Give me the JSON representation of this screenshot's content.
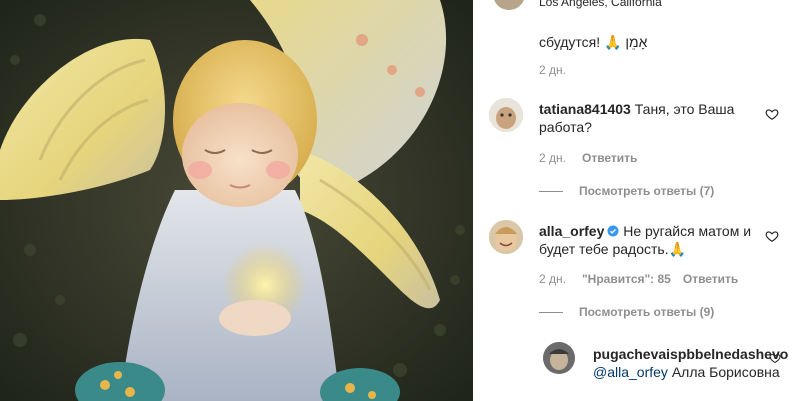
{
  "post": {
    "location": "Los Angeles, California"
  },
  "comments": [
    {
      "text": "сбудутся! 🙏 אָמֵן",
      "time": "2 дн."
    },
    {
      "username": "tatiana841403",
      "text": "Таня, это Ваша работа?",
      "time": "2 дн.",
      "reply_label": "Ответить",
      "view_replies": "Посмотреть ответы (7)"
    },
    {
      "username": "alla_orfey",
      "verified": true,
      "text": "Не ругайся матом и будет тебе радость.🙏",
      "time": "2 дн.",
      "likes": "\"Нравится\": 85",
      "reply_label": "Ответить",
      "view_replies": "Посмотреть ответы (9)"
    }
  ],
  "reply": {
    "username": "pugachevaispbbelnedashevo",
    "mention": "@alla_orfey",
    "text": "Алла Борисовна"
  },
  "icons": {
    "like": "heart-outline-icon",
    "verified": "verified-badge-icon",
    "prayer": "folded-hands-emoji"
  },
  "colors": {
    "text": "#262626",
    "secondary": "#8e8e8e",
    "link": "#00376b",
    "verified": "#3897f0"
  }
}
